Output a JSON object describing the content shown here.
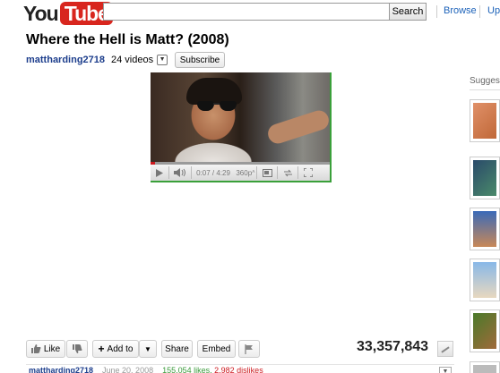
{
  "header": {
    "logo": {
      "you": "You",
      "tube": "Tube"
    },
    "search": {
      "value": "",
      "button_label": "Search"
    },
    "links": [
      "Browse",
      "Upl"
    ]
  },
  "video": {
    "title": "Where the Hell is Matt? (2008)",
    "channel": "mattharding2718",
    "videos_count": "24 videos",
    "subscribe_label": "Subscribe",
    "time": "0:07 / 4:29",
    "quality": "360p",
    "progress_fraction": 0.026
  },
  "sidebar": {
    "heading": "Sugges",
    "thumb_colors": [
      "#d08050",
      "#3a6a8a",
      "#4a7ac0",
      "#6aa0d8",
      "#5a8a3a",
      "#bbbbbb"
    ]
  },
  "actions": {
    "like_label": "Like",
    "add_to_label": "Add to",
    "share_label": "Share",
    "embed_label": "Embed",
    "views": "33,357,843"
  },
  "details": {
    "channel": "mattharding2718",
    "date": "June 20, 2008",
    "likes": "155,054 likes,",
    "dislikes": "2,982 dislikes"
  },
  "colors": {
    "accent": "#1c62b9",
    "brand": "#d8261e",
    "progress": "#cc181e"
  }
}
